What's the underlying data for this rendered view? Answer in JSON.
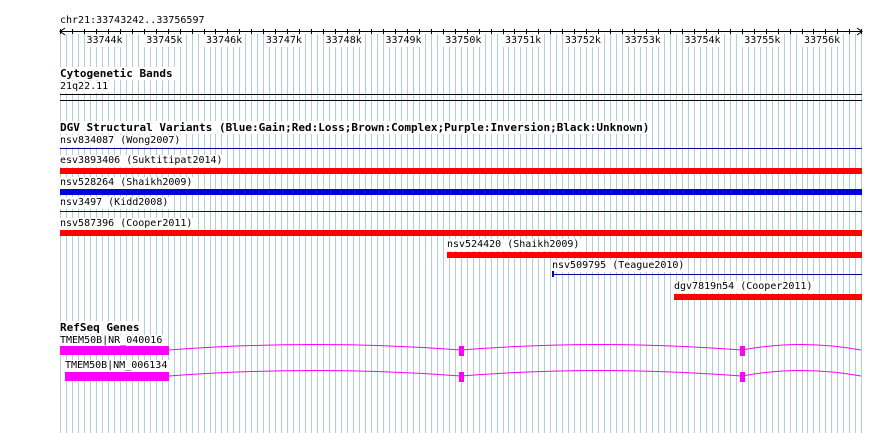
{
  "ruler": {
    "locus": "chr21:33743242..33756597",
    "ticks": [
      "33744k",
      "33745k",
      "33746k",
      "33747k",
      "33748k",
      "33749k",
      "33750k",
      "33751k",
      "33752k",
      "33753k",
      "33754k",
      "33755k",
      "33756k"
    ]
  },
  "tracks": {
    "cytoband": {
      "title": "Cytogenetic Bands",
      "band": "21q22.11"
    },
    "dgv": {
      "title": "DGV Structural Variants (Blue:Gain;Red:Loss;Brown:Complex;Purple:Inversion;Black:Unknown)",
      "variants": [
        {
          "label": "nsv834087 (Wong2007)",
          "type": "unknown"
        },
        {
          "label": "esv3893406 (Suktitipat2014)",
          "type": "loss"
        },
        {
          "label": "nsv528264 (Shaikh2009)",
          "type": "gain"
        },
        {
          "label": "nsv3497 (Kidd2008)",
          "type": "unknown"
        },
        {
          "label": "nsv587396 (Cooper2011)",
          "type": "loss"
        },
        {
          "label": "nsv524420 (Shaikh2009)",
          "type": "loss"
        },
        {
          "label": "nsv509795 (Teague2010)",
          "type": "unknown"
        },
        {
          "label": "dgv7819n54 (Cooper2011)",
          "type": "loss"
        }
      ]
    },
    "refseq": {
      "title": "RefSeq Genes",
      "transcripts": [
        {
          "label": "TMEM50B|NR_040016"
        },
        {
          "label": "TMEM50B|NM_006134"
        }
      ]
    }
  },
  "colors": {
    "loss": "#ff0000",
    "gain": "#0000dd",
    "unknown": "#000099",
    "gene": "#ff00ff",
    "grid": "#b4cdd9"
  }
}
